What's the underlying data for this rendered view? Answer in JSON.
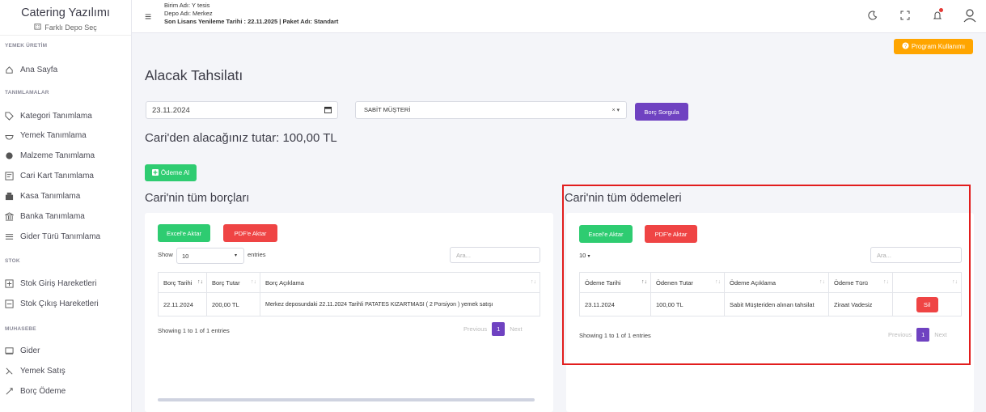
{
  "sidebar": {
    "title": "Catering Yazılımı",
    "subtitle": "Farklı Depo Seç",
    "sections": {
      "yemek_uretim": "YEMEK ÜRETİM",
      "tanimlamalar": "TANIMLAMALAR",
      "stok": "STOK",
      "muhasebe": "MUHASEBE"
    },
    "items": [
      {
        "label": "Ana Sayfa",
        "icon": "home-icon"
      },
      {
        "label": "Kategori Tanımlama",
        "icon": "tag-icon"
      },
      {
        "label": "Yemek Tanımlama",
        "icon": "bowl-icon"
      },
      {
        "label": "Malzeme Tanımlama",
        "icon": "ingredient-icon"
      },
      {
        "label": "Cari Kart Tanımlama",
        "icon": "card-icon"
      },
      {
        "label": "Kasa Tanımlama",
        "icon": "register-icon"
      },
      {
        "label": "Banka Tanımlama",
        "icon": "bank-icon"
      },
      {
        "label": "Gider Türü Tanımlama",
        "icon": "list-icon"
      },
      {
        "label": "Stok Giriş Hareketleri",
        "icon": "stock-in-icon"
      },
      {
        "label": "Stok Çıkış Hareketleri",
        "icon": "stock-out-icon"
      },
      {
        "label": "Gider",
        "icon": "expense-icon"
      },
      {
        "label": "Yemek Satış",
        "icon": "sale-icon"
      },
      {
        "label": "Borç Ödeme",
        "icon": "payment-icon"
      }
    ]
  },
  "header": {
    "birim": "Birim Adı: Y tesis",
    "depo": "Depo Adı: Merkez",
    "lisans": "Son Lisans Yenileme Tarihi : 22.11.2025 | Paket Adı: Standart"
  },
  "help_button": "Program Kullanımı",
  "page": {
    "title": "Alacak Tahsilatı",
    "date_value": "23.11.2024",
    "select_value": "SABİT MÜŞTERİ",
    "query_button": "Borç Sorgula",
    "amount_text": "Cari'den alacağınız tutar: 100,00 TL",
    "pay_button": "Ödeme Al"
  },
  "debts": {
    "title": "Cari'nin tüm borçları",
    "excel": "Excel'e Aktar",
    "pdf": "PDF'e Aktar",
    "show_label": "Show",
    "show_value": "10",
    "entries_label": "entries",
    "search_placeholder": "Ara...",
    "columns": [
      "Borç Tarihi",
      "Borç Tutar",
      "Borç Açıklama"
    ],
    "rows": [
      [
        "22.11.2024",
        "200,00 TL",
        "Merkez deposundaki 22.11.2024 Tarihli PATATES KIZARTMASI ( 2 Porsiyon ) yemek satışı"
      ]
    ],
    "info": "Showing 1 to 1 of 1 entries",
    "prev": "Previous",
    "page": "1",
    "next": "Next"
  },
  "payments": {
    "title": "Cari'nin tüm ödemeleri",
    "excel": "Excel'e Aktar",
    "pdf": "PDF'e Aktar",
    "show_value": "10",
    "search_placeholder": "Ara...",
    "columns": [
      "Ödeme Tarihi",
      "Ödenen Tutar",
      "Ödeme Açıklama",
      "Ödeme Türü",
      ""
    ],
    "rows": [
      [
        "23.11.2024",
        "100,00 TL",
        "Sabit Müşteriden alınan tahsilat",
        "Ziraat Vadesiz"
      ]
    ],
    "delete_label": "Sil",
    "info": "Showing 1 to 1 of 1 entries",
    "prev": "Previous",
    "page": "1",
    "next": "Next"
  }
}
